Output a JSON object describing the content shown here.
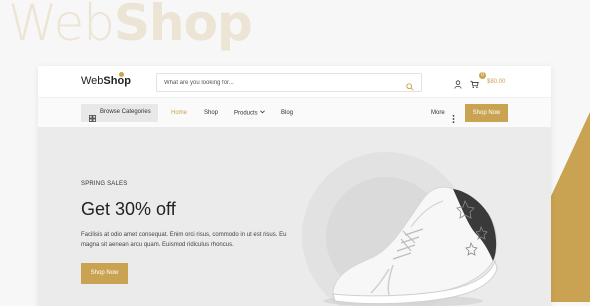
{
  "background": {
    "brand_light": "Web",
    "brand_bold": "Shop"
  },
  "header": {
    "logo_light": "Web",
    "logo_bold": "Shop",
    "search_placeholder": "What are you looking for...",
    "cart_count": "0",
    "cart_total": "$80.00",
    "icons": [
      "search-icon",
      "user-icon",
      "cart-icon"
    ]
  },
  "nav": {
    "browse_label": "Browse Categories",
    "items": [
      "Home",
      "Shop",
      "Products",
      "Blog"
    ],
    "active": "Home",
    "more_label": "More",
    "cta_label": "Shop Now"
  },
  "hero": {
    "subtitle": "SPRING SALES",
    "title": "Get 30% off",
    "description": "Facilisis at odio amet consequat. Enim orci risus, commodo in ut est risus. Eu magna sit aenean arcu quam. Euismod ridiculus rhoncus.",
    "cta_label": "Shop Now"
  },
  "colors": {
    "accent": "#c9a351",
    "hero_bg": "#ebebeb"
  }
}
